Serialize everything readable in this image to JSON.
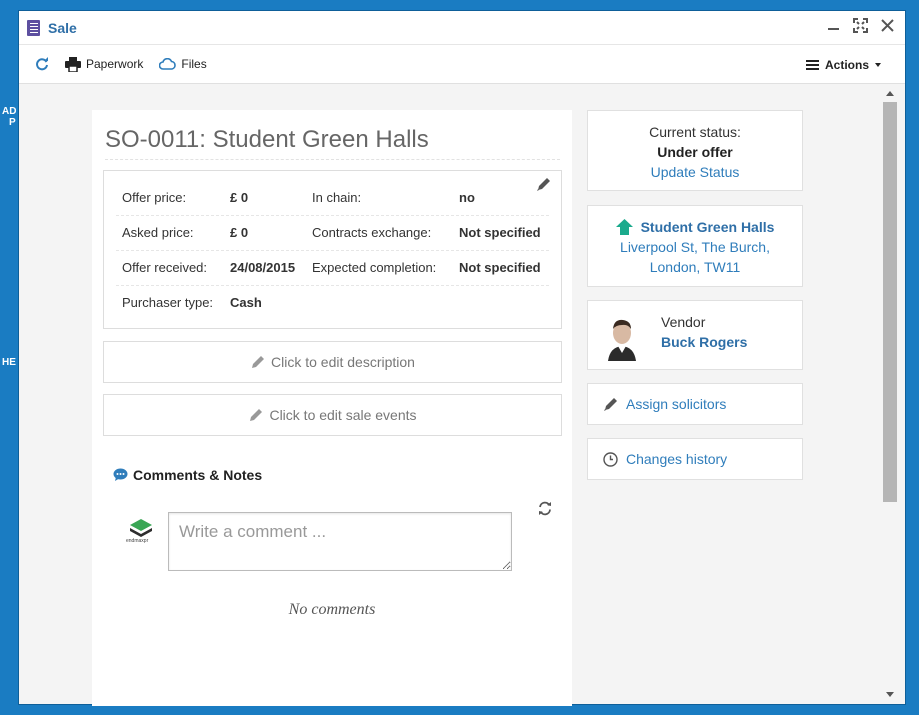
{
  "background": {
    "frag1": "AD",
    "frag2": "P",
    "frag3": "HE"
  },
  "window": {
    "title": "Sale"
  },
  "toolbar": {
    "paperwork": "Paperwork",
    "files": "Files",
    "actions": "Actions"
  },
  "sale": {
    "title": "SO-0011: Student Green Halls",
    "details": {
      "offer_price_label": "Offer price:",
      "offer_price": "£ 0",
      "in_chain_label": "In chain:",
      "in_chain": "no",
      "asked_price_label": "Asked price:",
      "asked_price": "£ 0",
      "contracts_label": "Contracts exchange:",
      "contracts": "Not specified",
      "offer_received_label": "Offer received:",
      "offer_received": "24/08/2015",
      "expected_label": "Expected completion:",
      "expected": "Not specified",
      "purchaser_label": "Purchaser type:",
      "purchaser": "Cash"
    },
    "edit_description": "Click to edit description",
    "edit_events": "Click to edit sale events"
  },
  "comments": {
    "heading": "Comments & Notes",
    "placeholder": "Write a comment ...",
    "logo_text": "endmaxpr",
    "empty": "No comments"
  },
  "status": {
    "label": "Current status:",
    "value": "Under offer",
    "update": "Update Status"
  },
  "property": {
    "name": "Student Green Halls",
    "address1": "Liverpool St, The Burch,",
    "address2": "London, TW11"
  },
  "vendor": {
    "role": "Vendor",
    "name": "Buck Rogers"
  },
  "side_links": {
    "assign": "Assign solicitors",
    "history": "Changes history"
  },
  "colors": {
    "accent": "#2f7dbb",
    "title": "#2f6fa7",
    "background": "#1a7cc2",
    "property_icon": "#1aaa8c"
  }
}
